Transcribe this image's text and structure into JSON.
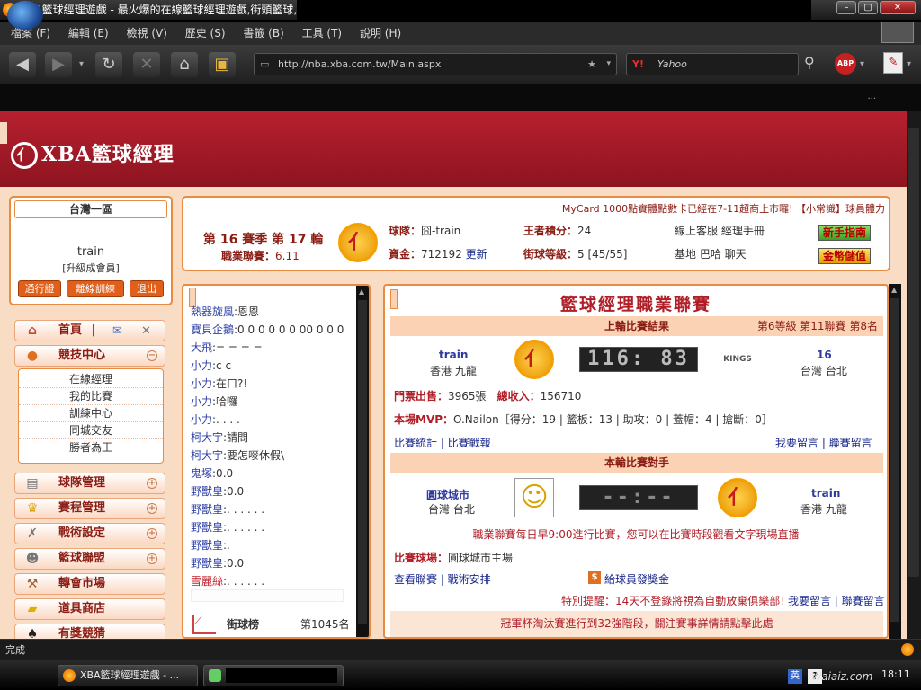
{
  "window": {
    "title": "XBA籃球經理遊戲 - 最火爆的在線籃球經理遊戲,街頭籃球,N",
    "menu": [
      "檔案 (F)",
      "編輯 (E)",
      "檢視 (V)",
      "歷史 (S)",
      "書籤 (B)",
      "工具 (T)",
      "說明 (H)"
    ],
    "url": "http://nba.xba.com.tw/Main.aspx",
    "search_placeholder": "Yahoo",
    "bookmarks_overflow": "..."
  },
  "site": {
    "logo_text": "XBA籃球經理"
  },
  "user_panel": {
    "region": "台灣一區",
    "username": "train",
    "member_type": "[升級成會員]",
    "buttons": [
      "通行證",
      "離線訓練",
      "退出"
    ]
  },
  "nav": {
    "home": "首頁",
    "home_sep": "|",
    "competition": "競技中心",
    "competition_sub": [
      "在線經理",
      "我的比賽",
      "訓練中心",
      "同城交友",
      "勝者為王"
    ],
    "sections": [
      "球隊管理",
      "賽程管理",
      "戰術設定",
      "籃球聯盟",
      "轉會市場",
      "道具商店",
      "有獎競猜"
    ]
  },
  "info": {
    "marquee": "MyCard 1000點實體點數卡已經在7-11超商上市囉! 【小常識】球員體力",
    "season": "第 16 賽季 第 17 輪",
    "league_label": "職業聯賽：",
    "league_value": "6.11",
    "team_label": "球隊：",
    "team_value": "囧-train",
    "money_label": "資金：",
    "money_value": "712192",
    "update": "更新",
    "king_label": "王者積分：",
    "king_value": "24",
    "level_label": "街球等級：",
    "level_value": "5 [45/55]",
    "links_1": "線上客服 經理手冊",
    "links_2": "基地 巴哈 聊天",
    "btn_guide": "新手指南",
    "btn_coins": "金幣儲值"
  },
  "chat": [
    {
      "name": "熱器旋風",
      "msg": ":恩恩"
    },
    {
      "name": "寶貝企鵝",
      "msg": ":0 0 0 0 0 0 00 0 0 0"
    },
    {
      "name": "大飛",
      "msg": ":= = = ="
    },
    {
      "name": "小力",
      "msg": ":c c"
    },
    {
      "name": "小力",
      "msg": ":在ㄇ?!"
    },
    {
      "name": "小力",
      "msg": ":哈囉"
    },
    {
      "name": "小力",
      "msg": ":. . . ."
    },
    {
      "name": "柯大宇",
      "msg": ":請問"
    },
    {
      "name": "柯大宇",
      "msg": ":要怎嘜休假\\"
    },
    {
      "name": "鬼塚",
      "msg": ":0.0"
    },
    {
      "name": "野獸皇",
      "msg": ":0.0"
    },
    {
      "name": "野獸皇",
      "msg": ":. . . . . ."
    },
    {
      "name": "野獸皇",
      "msg": ":. . . . . ."
    },
    {
      "name": "野獸皇",
      "msg": ":."
    },
    {
      "name": "野獸皇",
      "msg": ":0.0"
    },
    {
      "name": "雪麗絲",
      "msg": ":. . .   . . ."
    }
  ],
  "street_rank": {
    "label": "街球榜",
    "value": "第1045名"
  },
  "main": {
    "title": "籃球經理職業聯賽",
    "last_match_header": "上輪比賽結果",
    "last_match_rank": "第6等級 第11聯賽 第8名",
    "home_team": "train",
    "home_city": "香港 九龍",
    "score": "116: 83",
    "away_team": "16",
    "away_city": "台灣 台北",
    "away_logo_text": "KINGS",
    "ticket_label": "門票出售：",
    "ticket_value": "3965張",
    "income_label": "總收入：",
    "income_value": "156710",
    "mvp_label": "本場MVP：",
    "mvp_value": "O.Nailon［得分：19 | 籃板：13 | 助攻：0 | 蓋帽：4 | 搶斷：0］",
    "stats_links": "比賽統計 | 比賽戰報",
    "message_links": "我要留言 | 聯賽留言",
    "next_match_header": "本輪比賽對手",
    "opp_team": "圓球城市",
    "opp_city": "台灣 台北",
    "next_score": "--:--",
    "my_team": "train",
    "my_city": "香港 九龍",
    "schedule_note": "職業聯賽每日早9:00進行比賽，您可以在比賽時段觀看文字現場直播",
    "venue_label": "比賽球場：",
    "venue_value": "圓球城市主場",
    "view_links": "查看聯賽 | 戰術安排",
    "bonus_link": "給球員發獎金",
    "notice_label": "特別提醒：",
    "notice_text": "14天不登錄將視為自動放棄俱樂部!",
    "notice_links": "我要留言 | 聯賽留言",
    "cup_note": "冠軍杯淘汰賽進行到32強階段，關注賽事詳情請點擊此處"
  },
  "status": "完成",
  "taskbar": {
    "task1": "XBA籃球經理遊戲 - ...",
    "clock": "18:11",
    "watermark": "Waiaiz.com"
  }
}
